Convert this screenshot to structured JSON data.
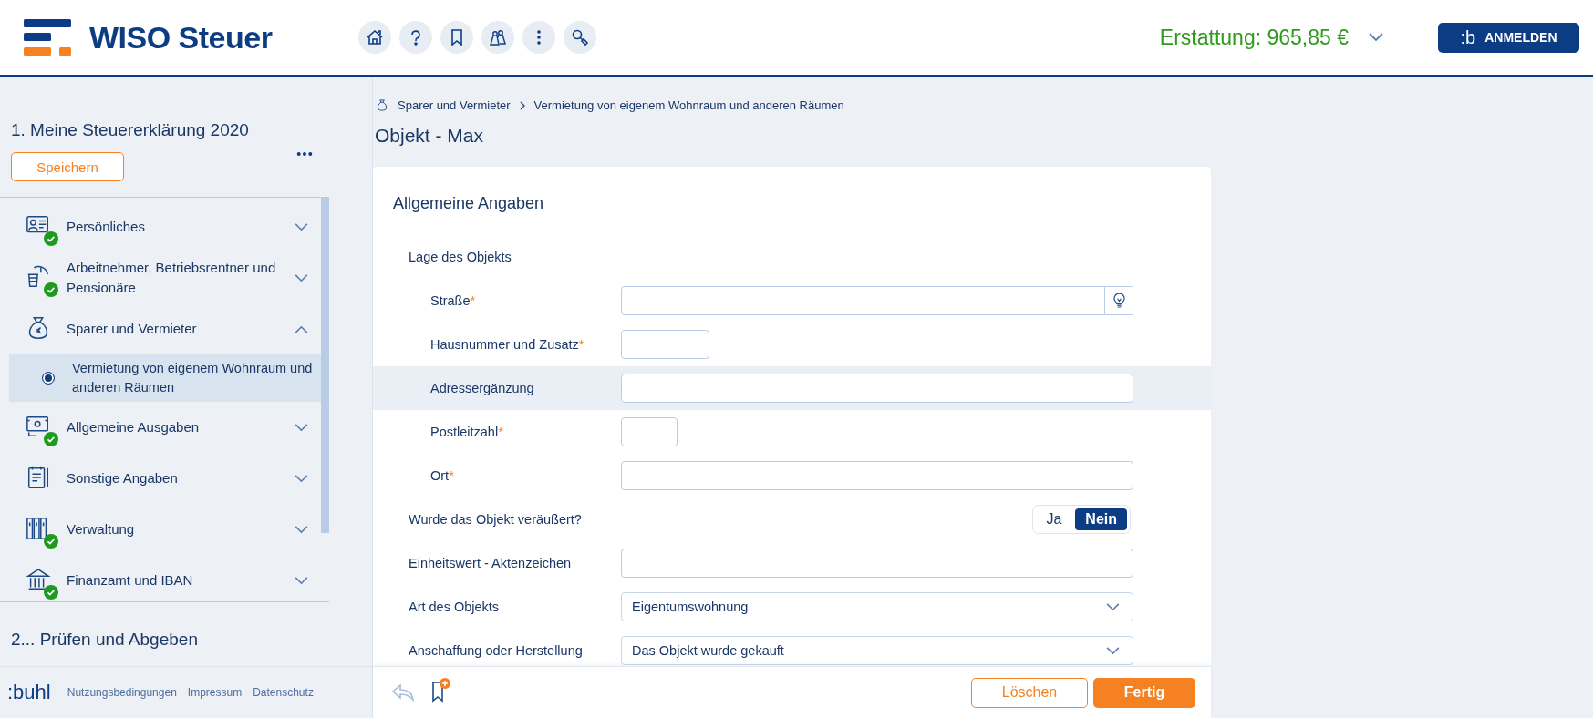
{
  "header": {
    "logo_text": "WISO Steuer",
    "refund": "Erstattung: 965,85 €",
    "login_badge": ":b",
    "login_label": "ANMELDEN"
  },
  "sidebar": {
    "title": "1. Meine Steuererklärung 2020",
    "save_label": "Speichern",
    "items": [
      {
        "label": "Persönliches",
        "done": true,
        "expanded": false
      },
      {
        "label": "Arbeitnehmer, Betriebsrentner und Pensionäre",
        "done": true,
        "expanded": false
      },
      {
        "label": "Sparer und Vermieter",
        "done": false,
        "expanded": true,
        "children": [
          {
            "label": "Vermietung von eigenem Wohnraum und anderen Räumen",
            "selected": true
          }
        ]
      },
      {
        "label": "Allgemeine Ausgaben",
        "done": true,
        "expanded": false
      },
      {
        "label": "Sonstige Angaben",
        "done": false,
        "expanded": false
      },
      {
        "label": "Verwaltung",
        "done": true,
        "expanded": false
      },
      {
        "label": "Finanzamt und IBAN",
        "done": true,
        "expanded": false
      }
    ],
    "next_step": "2... Prüfen und Abgeben"
  },
  "footer": {
    "logo": ":buhl",
    "links": [
      "Nutzungsbedingungen",
      "Impressum",
      "Datenschutz"
    ]
  },
  "breadcrumb": [
    "Sparer und Vermieter",
    "Vermietung von eigenem Wohnraum und anderen Räumen"
  ],
  "page_title": "Objekt - Max",
  "form": {
    "title": "Allgemeine Angaben",
    "rows": [
      {
        "kind": "section",
        "label": "Lage des Objekts",
        "children": [
          {
            "kind": "lookup",
            "label": "Straße",
            "mark": "*",
            "highlighted": false
          },
          {
            "kind": "short",
            "label": "Hausnummer und Zusatz",
            "mark": "*",
            "highlighted": false
          },
          {
            "kind": "text",
            "label": "Adressergänzung",
            "highlighted": true
          },
          {
            "kind": "tiny",
            "label": "Postleitzahl",
            "mark": "*",
            "highlighted": false
          },
          {
            "kind": "text",
            "label": "Ort",
            "mark": "*",
            "highlighted": false
          }
        ]
      },
      {
        "kind": "toggle",
        "label": "Wurde das Objekt veräußert?",
        "highlighted": false,
        "options": [
          {
            "label": "Ja",
            "selected": false
          },
          {
            "label": "Nein",
            "selected": true
          }
        ]
      },
      {
        "kind": "text",
        "label": "Einheitswert - Aktenzeichen",
        "highlighted": false
      },
      {
        "kind": "select",
        "label": "Art des Objekts",
        "value": "Eigentumswohnung",
        "highlighted": false
      },
      {
        "kind": "select",
        "label": "Anschaffung oder Herstellung",
        "value": "Das Objekt wurde gekauft",
        "highlighted": false
      }
    ]
  },
  "actions": {
    "back_disabled": true,
    "delete_label": "Löschen",
    "done_label": "Fertig"
  }
}
